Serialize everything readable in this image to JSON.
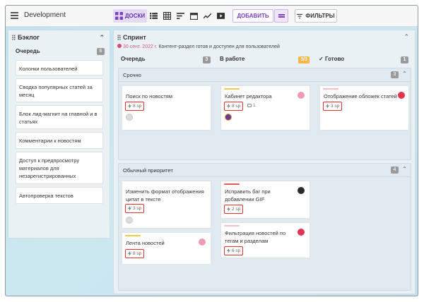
{
  "app": {
    "title": "Development"
  },
  "toolbar": {
    "boards_label": "ДОСКИ",
    "add_label": "ДОБАВИТЬ",
    "filter_label": "ФИЛЬТРЫ",
    "accent": "#6a2fb2"
  },
  "backlog": {
    "title": "Бэклог",
    "queue_label": "Очередь",
    "queue_count": "6",
    "items": [
      "Колонки пользователей",
      "Сводка популярных статей за месяц",
      "Блок лид-магнит на главной и в статьях",
      "Комментарии к новостям",
      "Доступ к предпросмотру материалов для незарегистрированных",
      "Автопроверка текстов"
    ]
  },
  "sprint": {
    "title": "Спринт",
    "date": "30 сент. 2022 г.",
    "description": "Контент-раздел готов и доступен для пользователей",
    "columns": [
      {
        "label": "Очередь",
        "count": "3"
      },
      {
        "label": "В работе",
        "count": "3/3"
      },
      {
        "label": "Готово",
        "count": "1"
      }
    ],
    "lanes": [
      {
        "title": "Срочно",
        "count": "3",
        "cards": [
          {
            "title": "Поиск по новостям",
            "sp": "8 sp"
          },
          {
            "title": "Кабинет редактора",
            "sp": "8 sp",
            "comments": "1",
            "bar_color": "#f2c94c"
          },
          {
            "title": "Отображение обложек статей",
            "sp": "3 sp",
            "bar_color": "#f4c0c8"
          }
        ]
      },
      {
        "title": "Обычный приоритет",
        "count": "4",
        "cards": [
          {
            "title": "Изменить формат отображения цитат в тексте",
            "sp": "3 sp"
          },
          {
            "title": "Лента новостей",
            "sp": "8 sp",
            "bar_color": "#f2c94c"
          },
          {
            "title": "Исправить баг при добавлении GIF",
            "sp": "2 sp",
            "bar_color": "#e85a5a"
          },
          {
            "title": "Фильтрация новостей по тегам и разделам",
            "sp": "6 sp",
            "bar_color": "#f4c0c8"
          }
        ]
      }
    ]
  }
}
